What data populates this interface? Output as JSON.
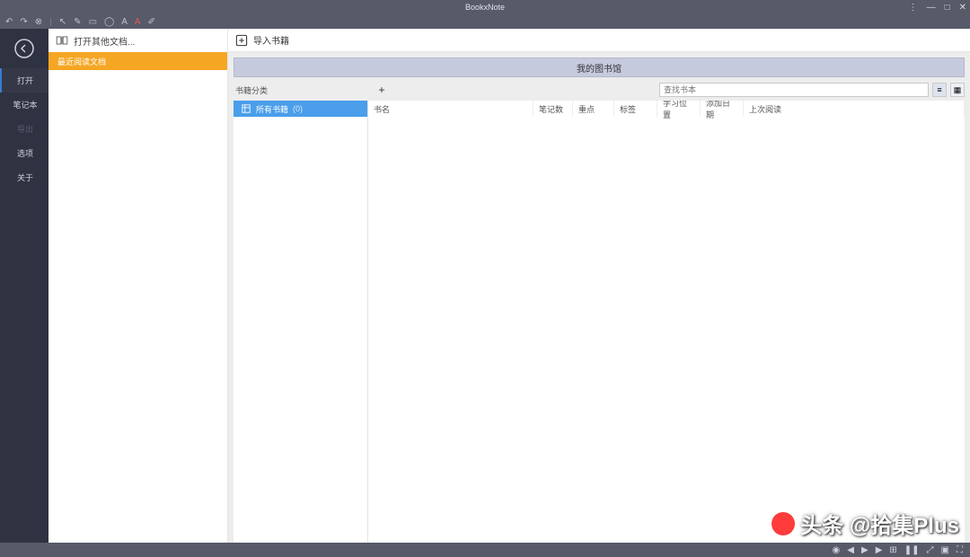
{
  "app": {
    "title": "BookxNote"
  },
  "window_controls": {
    "menu": "⋮",
    "minimize": "—",
    "maximize": "□",
    "close": "✕"
  },
  "toolbar_icons": [
    "undo",
    "redo",
    "close-circle",
    "separator",
    "pointer",
    "pen",
    "rect",
    "circle",
    "text-a",
    "highlight-a",
    "note"
  ],
  "sidebar": {
    "items": [
      {
        "label": "打开",
        "active": true
      },
      {
        "label": "笔记本",
        "active": false
      },
      {
        "label": "导出",
        "active": false,
        "disabled": true
      },
      {
        "label": "选项",
        "active": false
      },
      {
        "label": "关于",
        "active": false
      }
    ]
  },
  "left_panel": {
    "header_label": "打开其他文档...",
    "recent_label": "最近阅读文档"
  },
  "main_panel": {
    "import_label": "导入书籍",
    "library_title": "我的图书馆",
    "classify_label": "书籍分类",
    "search_placeholder": "查找书本",
    "tree": {
      "item_label": "所有书籍",
      "count": "(0)"
    },
    "columns": [
      "书名",
      "笔记数",
      "重点",
      "标签",
      "学习位置",
      "添加日期",
      "上次阅读"
    ]
  },
  "watermark": "头条 @拾集Plus",
  "bottom_icons": [
    "sphere",
    "prev",
    "play",
    "next",
    "grid",
    "pause",
    "expand",
    "record",
    "fullscreen"
  ]
}
